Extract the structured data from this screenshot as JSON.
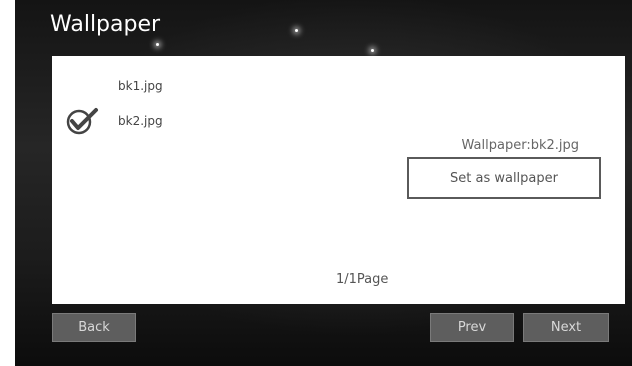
{
  "window": {
    "title": "Wallpaper"
  },
  "files": [
    {
      "name": "bk1.jpg",
      "selected": false
    },
    {
      "name": "bk2.jpg",
      "selected": true
    }
  ],
  "icons": {
    "selected_marker": "checkmark-circle-icon"
  },
  "current_wallpaper": "Wallpaper:bk2.jpg",
  "actions": {
    "set_as_wallpaper": "Set as wallpaper",
    "back": "Back",
    "prev": "Prev",
    "next": "Next"
  },
  "pagination": {
    "label": "1/1Page",
    "current": 1,
    "total": 1
  },
  "colors": {
    "background": "#1c1c1c",
    "panel": "#ffffff",
    "button": "#5e5e5e",
    "button_text": "#d8d8d8"
  }
}
